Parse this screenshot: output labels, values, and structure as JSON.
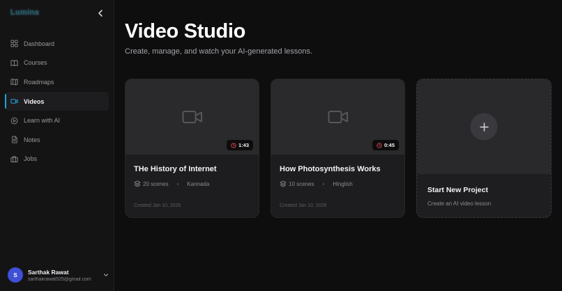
{
  "sidebar": {
    "logo": "Lumina",
    "items": [
      {
        "label": "Dashboard",
        "icon": "dashboard-icon",
        "active": false
      },
      {
        "label": "Courses",
        "icon": "book-icon",
        "active": false
      },
      {
        "label": "Roadmaps",
        "icon": "map-icon",
        "active": false
      },
      {
        "label": "Videos",
        "icon": "video-icon",
        "active": true
      },
      {
        "label": "Learn with AI",
        "icon": "play-circle-icon",
        "active": false
      },
      {
        "label": "Notes",
        "icon": "notes-icon",
        "active": false
      },
      {
        "label": "Jobs",
        "icon": "briefcase-icon",
        "active": false
      }
    ],
    "user": {
      "initial": "S",
      "name": "Sarthak Rawat",
      "email": "sarthakrawat525@gmail.com"
    }
  },
  "main": {
    "title": "Video Studio",
    "subtitle": "Create, manage, and watch your AI-generated lessons.",
    "videos": [
      {
        "title": "THe History of Internet",
        "duration": "1:43",
        "scenes": "20 scenes",
        "language": "Kannada",
        "created": "Created Jan 10, 2026"
      },
      {
        "title": "How Photosynthesis Works",
        "duration": "0:45",
        "scenes": "10 scenes",
        "language": "Hinglish",
        "created": "Created Jan 10, 2026"
      }
    ],
    "new_project": {
      "title": "Start New Project",
      "subtitle": "Create an AI video lesson"
    }
  },
  "colors": {
    "accent": "#1ea3d9",
    "avatar": "#3f4fd6",
    "background": "#0e0e0f"
  }
}
